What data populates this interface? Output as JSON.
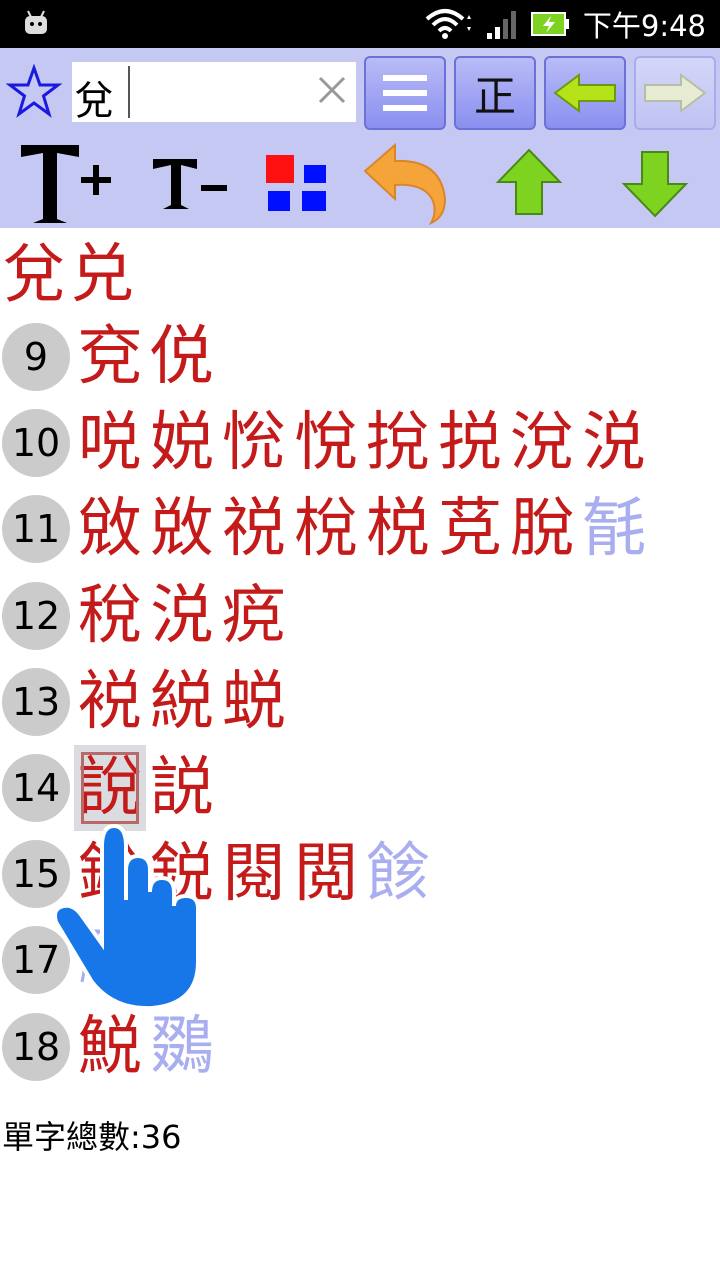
{
  "status_bar": {
    "time": "下午9:48"
  },
  "toolbar": {
    "search_value": "兌",
    "button_menu": "☰",
    "button_zheng": "正"
  },
  "header_chars": [
    "兌",
    "兑"
  ],
  "rows": [
    {
      "num": "9",
      "chars": [
        {
          "c": "兗",
          "light": false
        },
        {
          "c": "侻",
          "light": false
        }
      ]
    },
    {
      "num": "10",
      "chars": [
        {
          "c": "哾",
          "light": false
        },
        {
          "c": "娧",
          "light": false
        },
        {
          "c": "恱",
          "light": false
        },
        {
          "c": "悅",
          "light": false
        },
        {
          "c": "挩",
          "light": false
        },
        {
          "c": "捝",
          "light": false
        },
        {
          "c": "涗",
          "light": false
        },
        {
          "c": "涚",
          "light": false
        }
      ]
    },
    {
      "num": "11",
      "chars": [
        {
          "c": "敓",
          "light": false
        },
        {
          "c": "敚",
          "light": false
        },
        {
          "c": "祱",
          "light": false
        },
        {
          "c": "梲",
          "light": false
        },
        {
          "c": "棁",
          "light": false
        },
        {
          "c": "莌",
          "light": false
        },
        {
          "c": "脫",
          "light": false
        },
        {
          "c": "毻",
          "light": true
        }
      ]
    },
    {
      "num": "12",
      "chars": [
        {
          "c": "稅",
          "light": false
        },
        {
          "c": "涚",
          "light": false
        },
        {
          "c": "痥",
          "light": false
        }
      ]
    },
    {
      "num": "13",
      "chars": [
        {
          "c": "裞",
          "light": false
        },
        {
          "c": "綐",
          "light": false
        },
        {
          "c": "蜕",
          "light": false
        }
      ]
    },
    {
      "num": "14",
      "chars": [
        {
          "c": "說",
          "light": false,
          "selected": true
        },
        {
          "c": "説",
          "light": false
        }
      ]
    },
    {
      "num": "15",
      "chars": [
        {
          "c": "銳",
          "light": false
        },
        {
          "c": "鋭",
          "light": false
        },
        {
          "c": "閱",
          "light": false
        },
        {
          "c": "閲",
          "light": false
        },
        {
          "c": "餩",
          "light": true
        }
      ]
    },
    {
      "num": "17",
      "chars": [
        {
          "c": "駾",
          "light": true
        }
      ]
    },
    {
      "num": "18",
      "chars": [
        {
          "c": "鮵",
          "light": false
        },
        {
          "c": "鵽",
          "light": true
        }
      ]
    }
  ],
  "total_label": "單字總數:36",
  "colors": {
    "accent_red": "#c41a1a",
    "light_blue": "#a9aef0",
    "toolbar_bg": "#c6c8f4"
  }
}
